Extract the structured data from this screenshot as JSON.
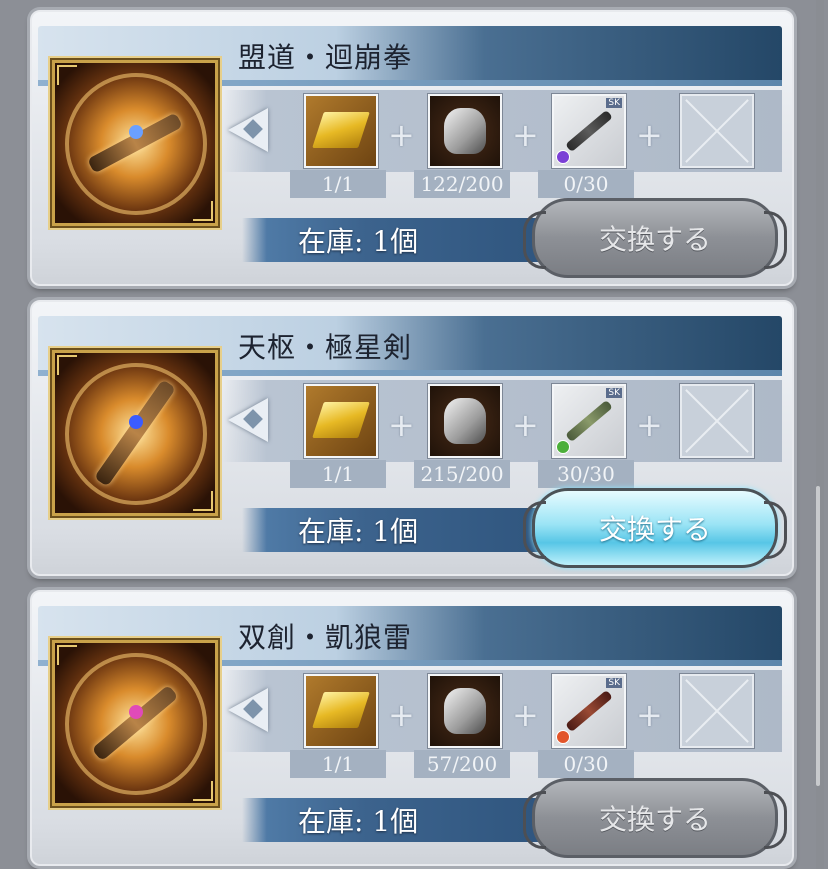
{
  "items": [
    {
      "title": "盟道・迴崩拳",
      "weapon_icon": "fist-weapon-icon",
      "weapon_gem_color": "#6aa0ff",
      "requirements": [
        {
          "icon": "gold-bar-icon",
          "count": "1/1"
        },
        {
          "icon": "silver-relic-icon",
          "count": "122/200"
        },
        {
          "icon": "gauntlet-weapon-icon",
          "element": "#7b3fd6",
          "count": "0/30"
        }
      ],
      "stock": "在庫: 1個",
      "button": {
        "label": "交換する",
        "state": "disabled"
      }
    },
    {
      "title": "天枢・極星剣",
      "weapon_icon": "sword-weapon-icon",
      "weapon_gem_color": "#3b5cff",
      "requirements": [
        {
          "icon": "gold-bar-icon",
          "count": "1/1"
        },
        {
          "icon": "silver-relic-icon",
          "count": "215/200"
        },
        {
          "icon": "sword-weapon-icon",
          "element": "#4caf3a",
          "count": "30/30"
        }
      ],
      "stock": "在庫: 1個",
      "button": {
        "label": "交換する",
        "state": "enabled"
      }
    },
    {
      "title": "双創・凱狼雷",
      "weapon_icon": "gun-weapon-icon",
      "weapon_gem_color": "#e04ab8",
      "requirements": [
        {
          "icon": "gold-bar-icon",
          "count": "1/1"
        },
        {
          "icon": "silver-relic-icon",
          "count": "57/200"
        },
        {
          "icon": "gun-weapon-icon",
          "element": "#e2552a",
          "count": "0/30"
        }
      ],
      "stock": "在庫: 1個",
      "button": {
        "label": "交換する",
        "state": "disabled"
      }
    }
  ],
  "sk_badge": "SK"
}
